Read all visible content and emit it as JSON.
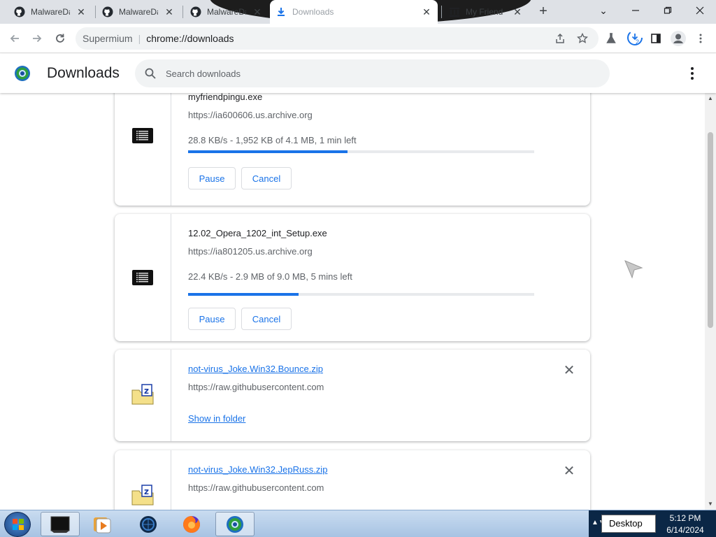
{
  "tabs": [
    {
      "label": "MalwareDatabase",
      "icon": "github-icon"
    },
    {
      "label": "MalwareDatabase",
      "icon": "github-icon"
    },
    {
      "label": "MalwareDatabase",
      "icon": "github-icon"
    },
    {
      "label": "Downloads",
      "icon": "download-icon"
    },
    {
      "label": "My Friend Pingu",
      "icon": "archive-icon"
    }
  ],
  "toolbar": {
    "origin": "Supermium",
    "url": "chrome://downloads",
    "download_badge": "2"
  },
  "header": {
    "title": "Downloads",
    "search_placeholder": "Search downloads"
  },
  "downloads": [
    {
      "name": "myfriendpingu.exe",
      "source": "https://ia600606.us.archive.org",
      "status": "28.8 KB/s - 1,952 KB of 4.1 MB, 1 min left",
      "progress": 0.46,
      "pause_label": "Pause",
      "cancel_label": "Cancel"
    },
    {
      "name": "12.02_Opera_1202_int_Setup.exe",
      "source": "https://ia801205.us.archive.org",
      "status": "22.4 KB/s - 2.9 MB of 9.0 MB, 5 mins left",
      "progress": 0.32,
      "pause_label": "Pause",
      "cancel_label": "Cancel"
    },
    {
      "name": "not-virus_Joke.Win32.Bounce.zip",
      "source": "https://raw.githubusercontent.com",
      "action": "Show in folder"
    },
    {
      "name": "not-virus_Joke.Win32.JepRuss.zip",
      "source": "https://raw.githubusercontent.com"
    }
  ],
  "taskbar": {
    "desktop_label": "Desktop",
    "time": "5:12 PM",
    "date": "6/14/2024"
  },
  "colors": {
    "accent": "#1a73e8",
    "taskbar": "#b5cde8",
    "tray": "#0b2746"
  }
}
